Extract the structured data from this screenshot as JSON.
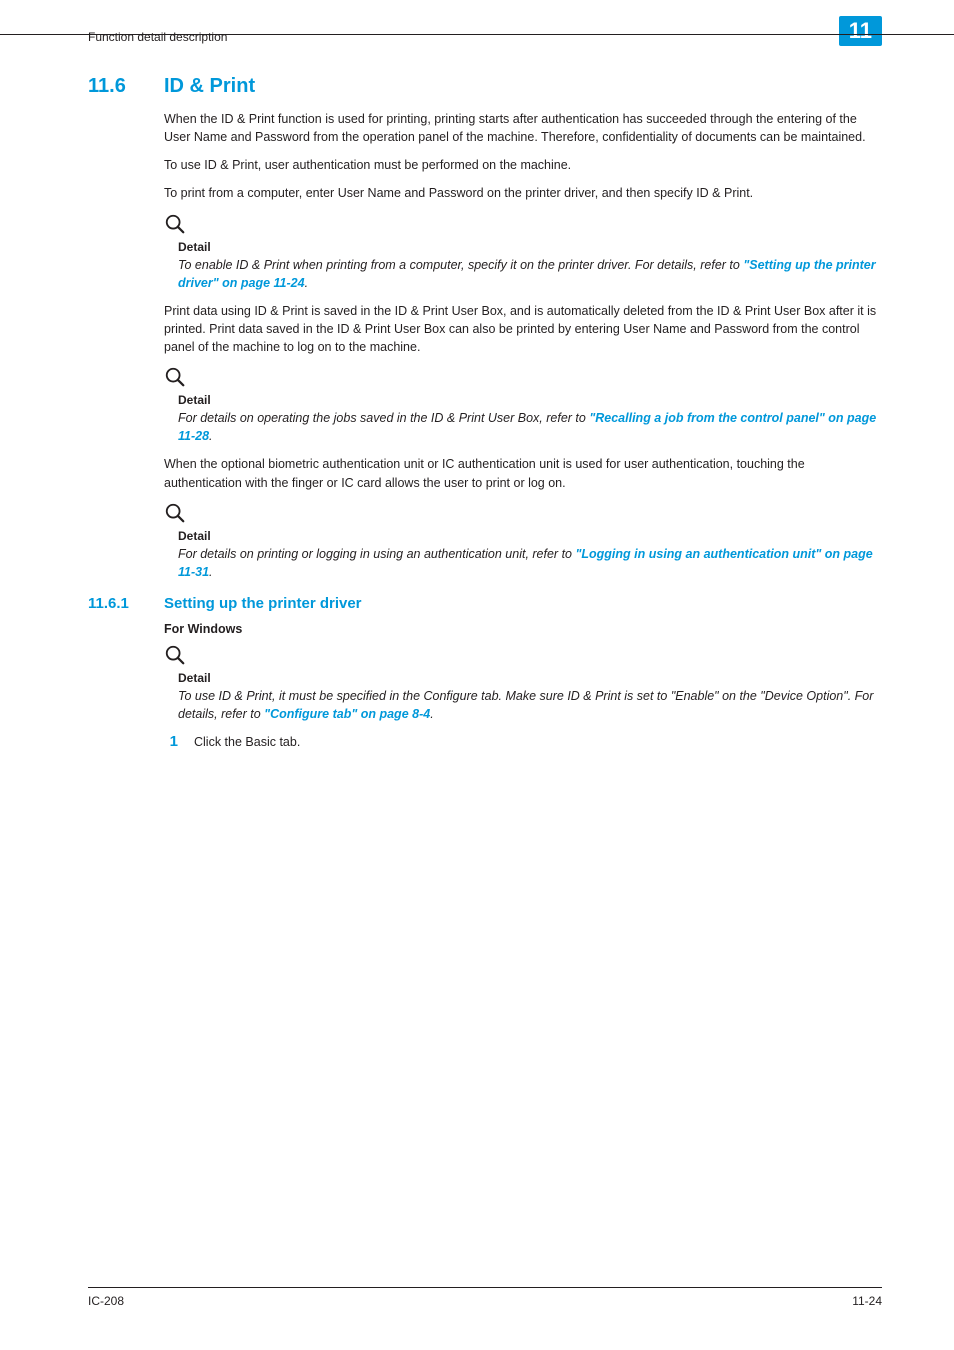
{
  "header": {
    "running_head": "Function detail description",
    "chapter_num": "11"
  },
  "h1": {
    "num": "11.6",
    "title": "ID & Print"
  },
  "p1": "When the ID & Print function is used for printing, printing starts after authentication has succeeded through the entering of the User Name and Password from the operation panel of the machine. Therefore, confidentiality of documents can be maintained.",
  "p2": "To use ID & Print, user authentication must be performed on the machine.",
  "p3": "To print from a computer, enter User Name and Password on the printer driver, and then specify ID & Print.",
  "detail_label": "Detail",
  "d1_pre": "To enable ID & Print when printing from a computer, specify it on the printer driver. For details, refer to ",
  "d1_link": "\"Setting up the printer driver\" on page 11-24",
  "period": ".",
  "p4": "Print data using ID & Print is saved in the ID & Print User Box, and is automatically deleted from the ID & Print User Box after it is printed. Print data saved in the ID & Print User Box can also be printed by entering User Name and Password from the control panel of the machine to log on to the machine.",
  "d2_pre": "For details on operating the jobs saved in the ID & Print User Box, refer to ",
  "d2_link": "\"Recalling a job from the control panel\" on page 11-28",
  "p5": "When the optional biometric authentication unit or IC authentication unit is used for user authentication, touching the authentication with the finger or IC card allows the user to print or log on.",
  "d3_pre": "For details on printing or logging in using an authentication unit, refer to ",
  "d3_link": "\"Logging in using an authentication unit\" on page 11-31",
  "h2": {
    "num": "11.6.1",
    "title": "Setting up the printer driver"
  },
  "h4": "For Windows",
  "d4_pre": "To use ID & Print, it must be specified in the Configure tab. Make sure ID & Print is set to \"Enable\" on the \"Device Option\". For details, refer to ",
  "d4_link": "\"Configure tab\" on page 8-4",
  "step1_num": "1",
  "step1_text": "Click the Basic tab.",
  "footer": {
    "left": "IC-208",
    "right": "11-24"
  }
}
